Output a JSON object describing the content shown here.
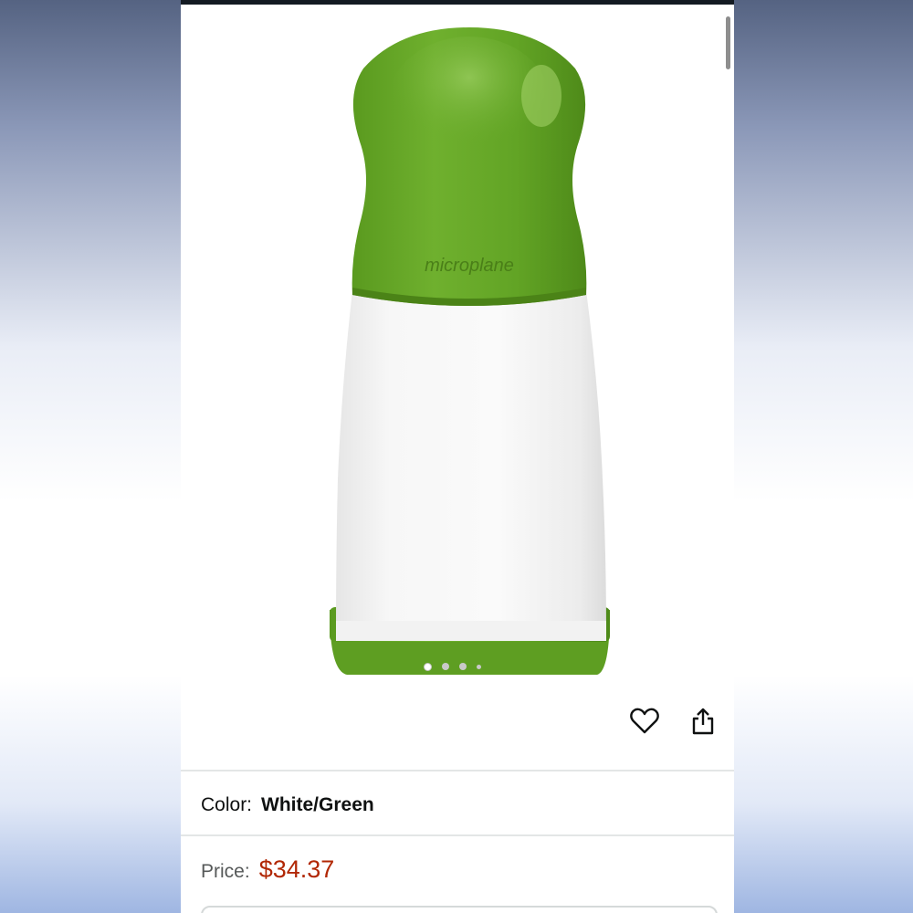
{
  "product": {
    "brand_mark": "microplane",
    "image_count": 4,
    "active_image_index": 1
  },
  "actions": {
    "wishlist_icon": "heart-icon",
    "share_icon": "share-icon"
  },
  "variant": {
    "label": "Color:",
    "value": "White/Green"
  },
  "pricing": {
    "label": "Price:",
    "value": "$34.37"
  },
  "colors": {
    "price": "#b12704",
    "top_bar": "#131a22",
    "product_green": "#6aab2c",
    "product_white": "#f4f4f4"
  }
}
